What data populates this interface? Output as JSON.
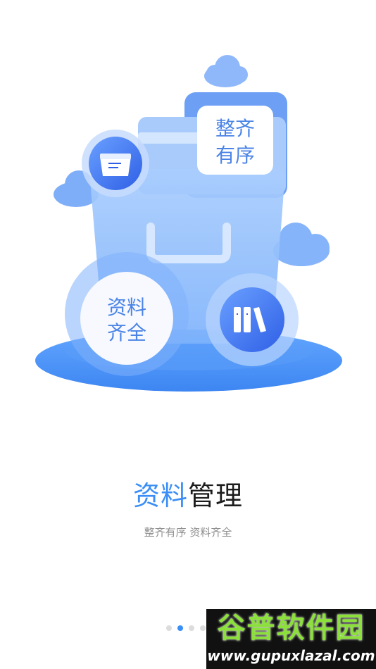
{
  "hero": {
    "bubble_top": "整齐\n有序",
    "bubble_top_line1": "整齐",
    "bubble_top_line2": "有序",
    "bubble_left_line1": "资料",
    "bubble_left_line2": "齐全",
    "icons": [
      "folder-box-icon",
      "books-icon"
    ]
  },
  "title": {
    "accent": "资料",
    "rest": "管理"
  },
  "subtitle": "整齐有序  资料齐全",
  "pager": {
    "count": 4,
    "active_index": 1
  },
  "watermark": {
    "brand": "谷普软件园",
    "url": "www.gupuxlazal.com"
  },
  "colors": {
    "accent": "#3a8ef5",
    "hero_light": "#cfe3ff",
    "hero_mid": "#8bb9ff",
    "hero_dark": "#3b74f0"
  }
}
